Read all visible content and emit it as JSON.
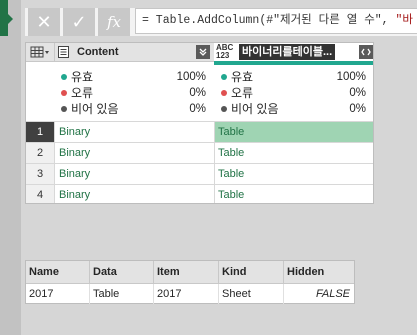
{
  "formula_bar": {
    "cancel_label": "✕",
    "confirm_label": "✓",
    "fx_label": "fx",
    "formula_prefix": "= Table.AddColumn(#\"제거된 다른 열 수\", ",
    "formula_string": "\"바"
  },
  "grid": {
    "columns": [
      {
        "name": "Content",
        "type_label": "Binary"
      },
      {
        "name": "바이너리를테이블...",
        "type_abc": "ABC",
        "type_123": "123"
      }
    ],
    "stats": [
      {
        "valid_label": "유효",
        "valid_pct": "100%",
        "error_label": "오류",
        "error_pct": "0%",
        "empty_label": "비어 있음",
        "empty_pct": "0%"
      },
      {
        "valid_label": "유효",
        "valid_pct": "100%",
        "error_label": "오류",
        "error_pct": "0%",
        "empty_label": "비어 있음",
        "empty_pct": "0%"
      }
    ],
    "rows": [
      {
        "num": "1",
        "content": "Binary",
        "table": "Table"
      },
      {
        "num": "2",
        "content": "Binary",
        "table": "Table"
      },
      {
        "num": "3",
        "content": "Binary",
        "table": "Table"
      },
      {
        "num": "4",
        "content": "Binary",
        "table": "Table"
      }
    ]
  },
  "preview": {
    "headers": [
      "Name",
      "Data",
      "Item",
      "Kind",
      "Hidden"
    ],
    "row": [
      "2017",
      "Table",
      "2017",
      "Sheet",
      "FALSE"
    ]
  },
  "colors": {
    "accent": "#217346",
    "valid_dot": "#21a78f",
    "error_dot": "#e05050",
    "empty_dot": "#555555",
    "selected_cell": "#9fd4b3"
  }
}
